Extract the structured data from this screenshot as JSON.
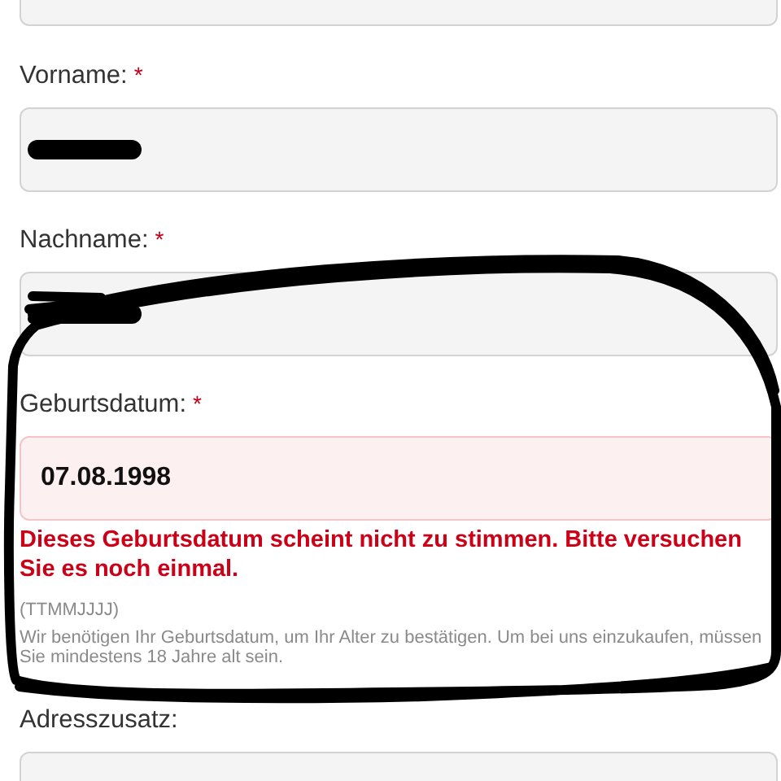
{
  "fields": [
    {
      "kind": "cut"
    },
    {
      "kind": "text",
      "label": "Vorname:",
      "required_mark": "*",
      "redacted": true
    },
    {
      "kind": "text",
      "label": "Nachname:",
      "required_mark": "*",
      "redacted": true
    },
    {
      "kind": "text",
      "label": "Geburtsdatum:",
      "required_mark": "*",
      "value": "07.08.1998",
      "invalid": true,
      "error": "Dieses Geburtsdatum scheint nicht zu stimmen. Bitte versuchen Sie es noch einmal.",
      "format": "(TTMMJJJJ)",
      "hint": "Wir benötigen Ihr Geburtsdatum, um Ihr Alter zu bestätigen. Um bei uns einzukaufen, müssen Sie mindestens 18 Jahre alt sein."
    },
    {
      "kind": "text",
      "label": "Adresszusatz:"
    }
  ],
  "annotation": {
    "kind": "scribble"
  }
}
